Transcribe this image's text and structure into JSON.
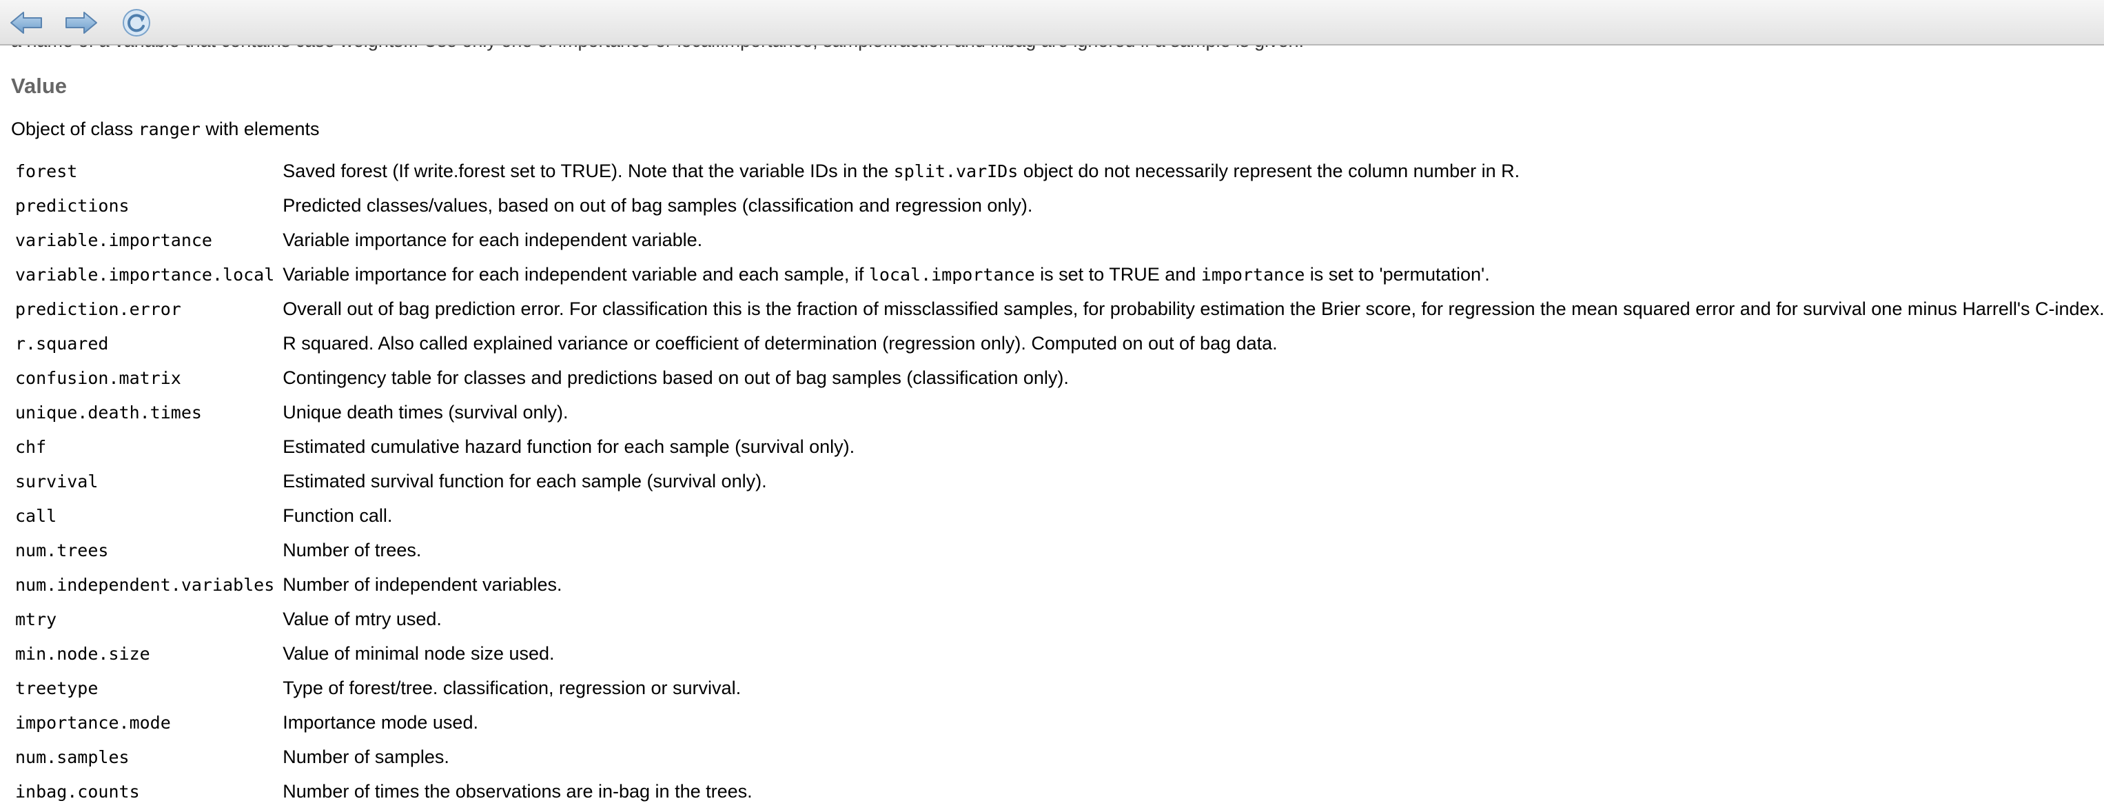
{
  "toolbar": {
    "back_icon": "back-arrow-icon",
    "forward_icon": "forward-arrow-icon",
    "refresh_icon": "refresh-icon"
  },
  "top_cut_text": "a name of a variable that contains case weights... Use only one of importance or local.importance, sample.fraction and inbag are ignored if a sample is given.",
  "section": {
    "title": "Value",
    "intro_prefix": "Object of class ",
    "intro_code": "ranger",
    "intro_suffix": " with elements"
  },
  "rows": [
    {
      "name": "forest",
      "desc": [
        {
          "t": "Saved forest (If write.forest set to TRUE). Note that the variable IDs in the "
        },
        {
          "c": "split.varIDs"
        },
        {
          "t": " object do not necessarily represent the column number in R."
        }
      ]
    },
    {
      "name": "predictions",
      "desc": [
        {
          "t": "Predicted classes/values, based on out of bag samples (classification and regression only)."
        }
      ]
    },
    {
      "name": "variable.importance",
      "desc": [
        {
          "t": "Variable importance for each independent variable."
        }
      ]
    },
    {
      "name": "variable.importance.local",
      "desc": [
        {
          "t": "Variable importance for each independent variable and each sample, if "
        },
        {
          "c": "local.importance"
        },
        {
          "t": " is set to TRUE and "
        },
        {
          "c": "importance"
        },
        {
          "t": " is set to 'permutation'."
        }
      ]
    },
    {
      "name": "prediction.error",
      "desc": [
        {
          "t": "Overall out of bag prediction error. For classification this is the fraction of missclassified samples, for probability estimation the Brier score, for regression the mean squared error and for survival one minus Harrell's C-index."
        }
      ]
    },
    {
      "name": "r.squared",
      "desc": [
        {
          "t": "R squared. Also called explained variance or coefficient of determination (regression only). Computed on out of bag data."
        }
      ]
    },
    {
      "name": "confusion.matrix",
      "desc": [
        {
          "t": "Contingency table for classes and predictions based on out of bag samples (classification only)."
        }
      ]
    },
    {
      "name": "unique.death.times",
      "desc": [
        {
          "t": "Unique death times (survival only)."
        }
      ]
    },
    {
      "name": "chf",
      "desc": [
        {
          "t": "Estimated cumulative hazard function for each sample (survival only)."
        }
      ]
    },
    {
      "name": "survival",
      "desc": [
        {
          "t": "Estimated survival function for each sample (survival only)."
        }
      ]
    },
    {
      "name": "call",
      "desc": [
        {
          "t": "Function call."
        }
      ]
    },
    {
      "name": "num.trees",
      "desc": [
        {
          "t": "Number of trees."
        }
      ]
    },
    {
      "name": "num.independent.variables",
      "desc": [
        {
          "t": "Number of independent variables."
        }
      ]
    },
    {
      "name": "mtry",
      "desc": [
        {
          "t": "Value of mtry used."
        }
      ]
    },
    {
      "name": "min.node.size",
      "desc": [
        {
          "t": "Value of minimal node size used."
        }
      ]
    },
    {
      "name": "treetype",
      "desc": [
        {
          "t": "Type of forest/tree. classification, regression or survival."
        }
      ]
    },
    {
      "name": "importance.mode",
      "desc": [
        {
          "t": "Importance mode used."
        }
      ]
    },
    {
      "name": "num.samples",
      "desc": [
        {
          "t": "Number of samples."
        }
      ]
    },
    {
      "name": "inbag.counts",
      "desc": [
        {
          "t": "Number of times the observations are in-bag in the trees."
        }
      ]
    }
  ]
}
